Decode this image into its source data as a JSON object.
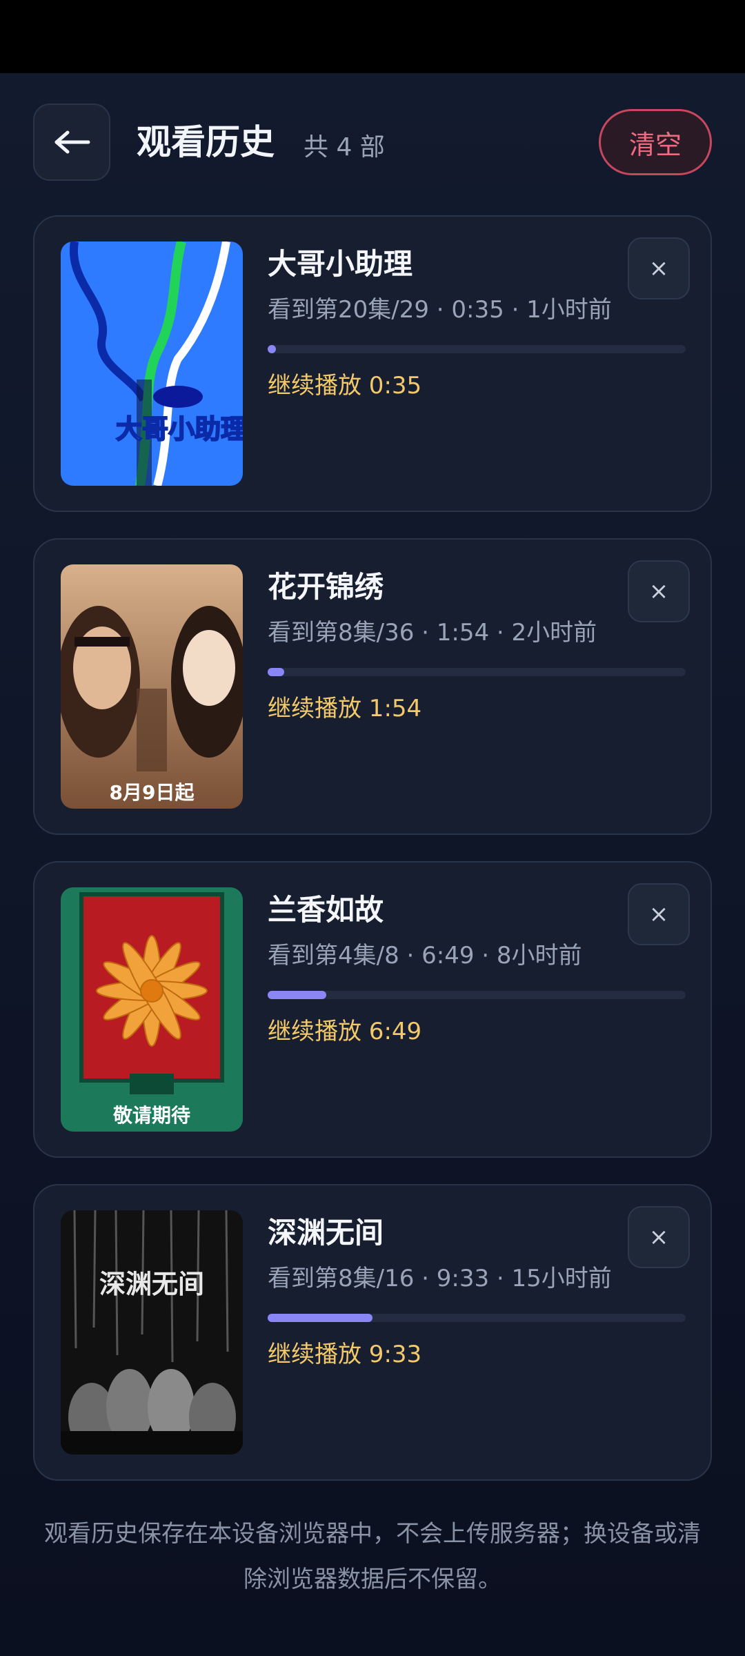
{
  "header": {
    "back_icon": "arrow-left-icon",
    "title": "观看历史",
    "count": "共 4 部",
    "clear_label": "清空"
  },
  "history": [
    {
      "title": "大哥小助理",
      "meta": "看到第20集/29 · 0:35 · 1小时前",
      "progress_pct": 2,
      "resume": "继续播放 0:35",
      "poster_text": "大哥小助理"
    },
    {
      "title": "花开锦绣",
      "meta": "看到第8集/36 · 1:54 · 2小时前",
      "progress_pct": 4,
      "resume": "继续播放 1:54",
      "poster_text": "8月9日起"
    },
    {
      "title": "兰香如故",
      "meta": "看到第4集/8 · 6:49 · 8小时前",
      "progress_pct": 14,
      "resume": "继续播放 6:49",
      "poster_text": "敬请期待"
    },
    {
      "title": "深渊无间",
      "meta": "看到第8集/16 · 9:33 · 15小时前",
      "progress_pct": 25,
      "resume": "继续播放 9:33",
      "poster_text": "深渊无间"
    }
  ],
  "remove_symbol": "×",
  "footer": "观看历史保存在本设备浏览器中，不会上传服务器；换设备或清除浏览器数据后不保留。"
}
